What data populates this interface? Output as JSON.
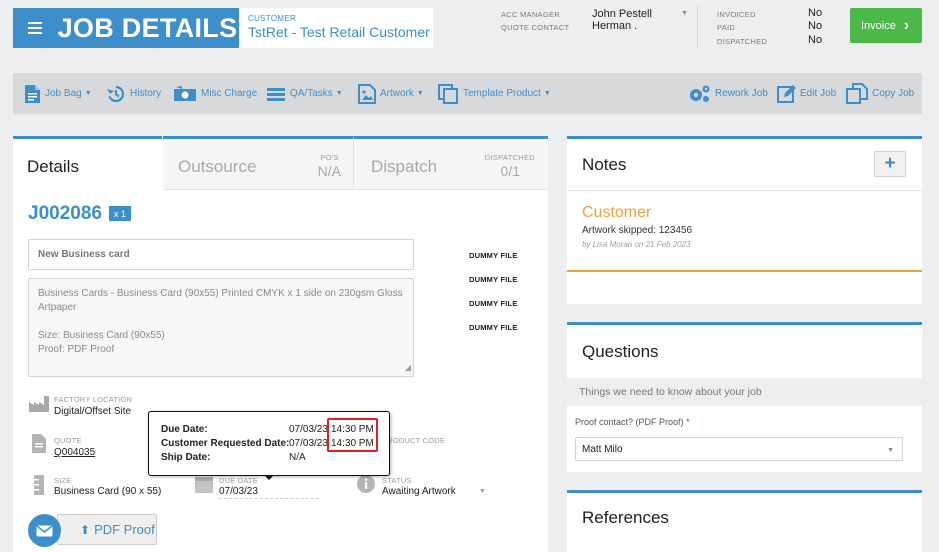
{
  "header": {
    "title": "JOB DETAILS",
    "customer_caption": "CUSTOMER",
    "customer_name": "TstRet - Test Retail Customer",
    "acc_manager_label": "ACC MANAGER",
    "acc_manager_value": "John Pestell",
    "quote_contact_label": "QUOTE CONTACT",
    "quote_contact_value": "Herman .",
    "invoiced_label": "INVOICED",
    "invoiced_value": "No",
    "paid_label": "PAID",
    "paid_value": "No",
    "dispatched_label": "DISPATCHED",
    "dispatched_value": "No",
    "invoice_button": "Invoice"
  },
  "toolbar": {
    "job_bag": "Job Bag",
    "history": "History",
    "misc_charge": "Misc Charge",
    "qa_tasks": "QA/Tasks",
    "artwork": "Artwork",
    "template_product": "Template Product",
    "rework_job": "Rework Job",
    "edit_job": "Edit Job",
    "copy_job": "Copy Job"
  },
  "tabs": {
    "details": "Details",
    "outsource": "Outsource",
    "pos_caption": "PO'S",
    "pos_value": "N/A",
    "dispatch": "Dispatch",
    "dispatched_caption": "DISPATCHED",
    "dispatched_value": "0/1"
  },
  "job": {
    "number": "J002086",
    "qty_badge": "x 1",
    "name": "New Business card",
    "description_line1": "Business Cards - Business Card (90x55)  Printed CMYK x 1 side  on 230gsm Gloss",
    "description_line2": "Artpaper",
    "description_line3": "Size: Business Card (90x55)",
    "description_line4": "Proof: PDF Proof",
    "dummy_files": [
      "DUMMY FILE",
      "DUMMY FILE",
      "DUMMY FILE",
      "DUMMY FILE"
    ],
    "factory_location_label": "FACTORY LOCATION",
    "factory_location_value": "Digital/Offset Site",
    "quote_label": "QUOTE",
    "quote_value": "Q004035",
    "product_code_label": "PRODUCT CODE",
    "size_label": "SIZE",
    "size_value": "Business Card (90 x 55)",
    "due_date_label": "DUE DATE",
    "due_date_value": "07/03/23",
    "status_label": "STATUS",
    "status_value": "Awaiting Artwork",
    "pdf_proof_button": "PDF Proof"
  },
  "tooltip": {
    "due_date_label": "Due Date:",
    "due_date_value": "07/03/23",
    "due_time_value": "14:30 PM",
    "customer_requested_label": "Customer Requested Date:",
    "customer_requested_value": "07/03/23",
    "customer_requested_time": "14:30 PM",
    "ship_date_label": "Ship Date:",
    "ship_date_value": "N/A"
  },
  "notes": {
    "title": "Notes",
    "author": "Customer",
    "text": "Artwork skipped: 123456",
    "meta": "by Lisa Moran on 21 Feb 2023"
  },
  "questions": {
    "title": "Questions",
    "subtitle": "Things we need to know about your job",
    "field_label": "Proof contact? (PDF Proof)",
    "required_mark": "*",
    "field_value": "Matt Milo"
  },
  "references": {
    "title": "References"
  },
  "colors": {
    "accent": "#3d8fcc",
    "invoice_green": "#4cb847",
    "note_orange": "#f0a23a",
    "highlight_red": "#e02020"
  }
}
